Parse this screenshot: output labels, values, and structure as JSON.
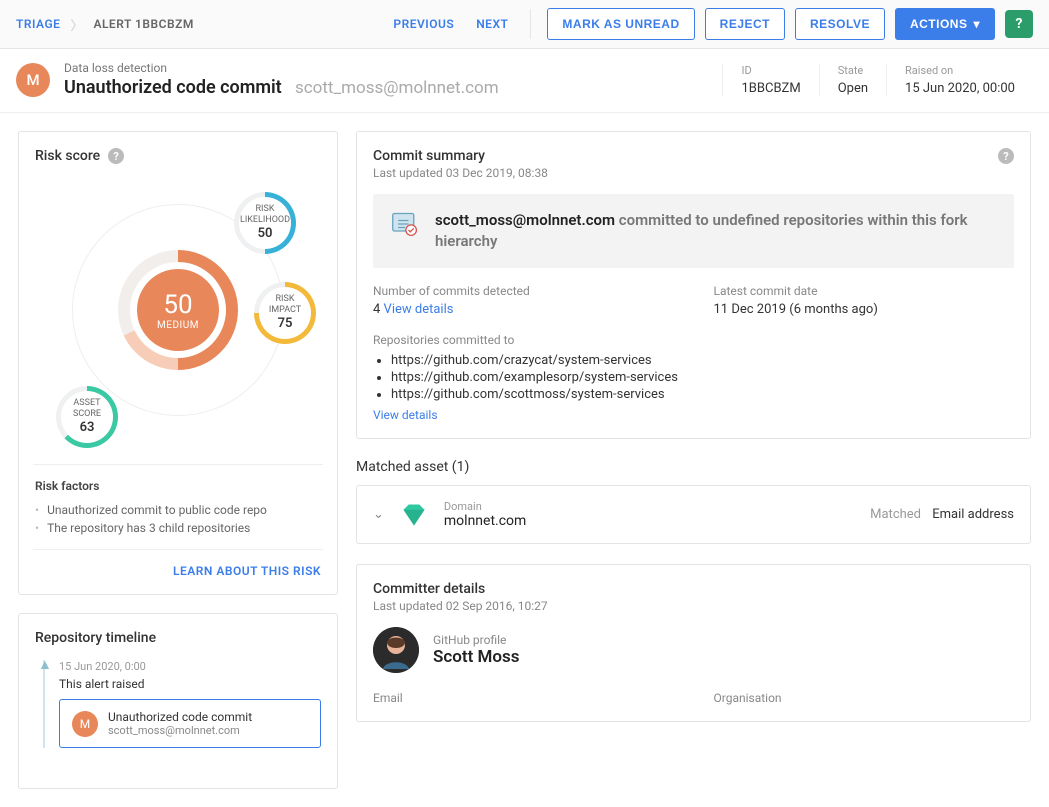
{
  "breadcrumb": {
    "triage": "TRIAGE",
    "current": "ALERT 1BBCBZM"
  },
  "nav": {
    "previous": "PREVIOUS",
    "next": "NEXT"
  },
  "actions": {
    "mark_unread": "MARK AS UNREAD",
    "reject": "REJECT",
    "resolve": "RESOLVE",
    "actions": "ACTIONS"
  },
  "header": {
    "kicker": "Data loss detection",
    "title": "Unauthorized code commit",
    "subtitle": "scott_moss@molnnet.com",
    "avatar_letter": "M",
    "meta": {
      "id_label": "ID",
      "id": "1BBCBZM",
      "state_label": "State",
      "state": "Open",
      "raised_label": "Raised on",
      "raised": "15 Jun 2020, 00:00"
    }
  },
  "risk": {
    "title": "Risk score",
    "score": "50",
    "score_label": "MEDIUM",
    "likelihood_label": "RISK\nLIKELIHOOD",
    "likelihood": "50",
    "impact_label": "RISK\nIMPACT",
    "impact": "75",
    "asset_label": "ASSET\nSCORE",
    "asset": "63",
    "factors_title": "Risk factors",
    "factors": [
      "Unauthorized commit to public code repo",
      "The repository has 3 child repositories"
    ],
    "learn": "LEARN ABOUT THIS RISK"
  },
  "timeline": {
    "title": "Repository timeline",
    "entry_date": "15 Jun 2020, 0:00",
    "entry_title": "This alert raised",
    "card_title": "Unauthorized code commit",
    "card_sub": "scott_moss@molnnet.com",
    "card_letter": "M"
  },
  "commit": {
    "title": "Commit summary",
    "updated": "Last updated 03 Dec 2019, 08:38",
    "banner_actor": "scott_moss@molnnet.com",
    "banner_rest": " committed to undefined repositories within this fork hierarchy",
    "commits_label": "Number of commits detected",
    "commits_count": "4",
    "view_details": "View details",
    "latest_label": "Latest commit date",
    "latest_value": "11 Dec 2019 (6 months ago)",
    "repos_label": "Repositories committed to",
    "repos": [
      "https://github.com/crazycat/system-services",
      "https://github.com/examplesorp/system-services",
      "https://github.com/scottmoss/system-services"
    ]
  },
  "matched": {
    "title": "Matched asset (1)",
    "type_label": "Domain",
    "value": "molnnet.com",
    "matched_label": "Matched",
    "matched_value": "Email address"
  },
  "committer": {
    "title": "Committer details",
    "updated": "Last updated 02 Sep 2016, 10:27",
    "profile_label": "GitHub profile",
    "name": "Scott Moss",
    "email_label": "Email",
    "org_label": "Organisation"
  }
}
